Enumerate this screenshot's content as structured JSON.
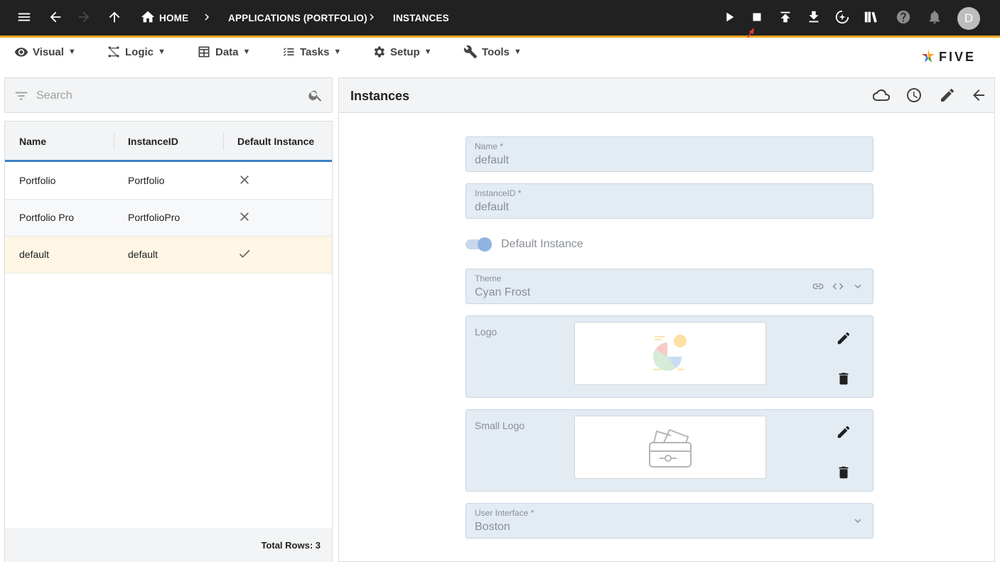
{
  "topbar": {
    "breadcrumbs": [
      "HOME",
      "APPLICATIONS (PORTFOLIO)",
      "INSTANCES"
    ],
    "avatar_initial": "D"
  },
  "menubar": {
    "items": [
      {
        "label": "Visual",
        "icon": "eye-icon"
      },
      {
        "label": "Logic",
        "icon": "logic-icon"
      },
      {
        "label": "Data",
        "icon": "table-icon"
      },
      {
        "label": "Tasks",
        "icon": "checklist-icon"
      },
      {
        "label": "Setup",
        "icon": "gear-icon"
      },
      {
        "label": "Tools",
        "icon": "tools-icon"
      }
    ],
    "caret": "▼",
    "brand": "FIVE"
  },
  "list": {
    "search_placeholder": "Search",
    "columns": [
      "Name",
      "InstanceID",
      "Default Instance"
    ],
    "rows": [
      {
        "name": "Portfolio",
        "instance_id": "Portfolio",
        "default": false
      },
      {
        "name": "Portfolio Pro",
        "instance_id": "PortfolioPro",
        "default": false
      },
      {
        "name": "default",
        "instance_id": "default",
        "default": true
      }
    ],
    "total_rows": "Total Rows: 3"
  },
  "form": {
    "title": "Instances",
    "name_label": "Name *",
    "name_value": "default",
    "instanceid_label": "InstanceID *",
    "instanceid_value": "default",
    "default_instance_label": "Default Instance",
    "default_instance_on": true,
    "theme_label": "Theme",
    "theme_value": "Cyan Frost",
    "logo_label": "Logo",
    "small_logo_label": "Small Logo",
    "ui_label": "User Interface *",
    "ui_value": "Boston"
  },
  "colors": {
    "topbar_bg": "#212121",
    "accent": "#f5a623",
    "selected_row": "#fff6e5",
    "header_underline": "#3f7fc7",
    "field_bg": "#e3ebf3"
  }
}
